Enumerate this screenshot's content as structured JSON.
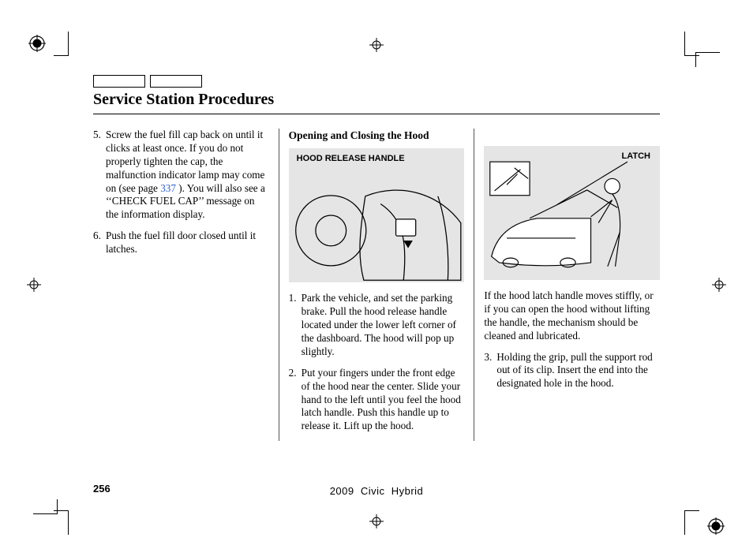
{
  "title": "Service Station Procedures",
  "subhead": "Opening and Closing the Hood",
  "col1": {
    "item5_num": "5.",
    "item5_a": "Screw the fuel fill cap back on until it clicks at least once. If you do not properly tighten the cap, the malfunction indicator lamp may come on (see page ",
    "item5_link": "337",
    "item5_b": " ). You will also see a ‘‘CHECK FUEL CAP’’ message on the information display.",
    "item6_num": "6.",
    "item6": "Push the fuel fill door closed until it latches."
  },
  "fig1_label": "HOOD RELEASE HANDLE",
  "fig2_label": "LATCH",
  "col2": {
    "item1_num": "1.",
    "item1": "Park the vehicle, and set the parking brake. Pull the hood release handle located under the lower left corner of the dashboard. The hood will pop up slightly.",
    "item2_num": "2.",
    "item2": "Put your fingers under the front edge of the hood near the center. Slide your hand to the left until you feel the hood latch handle. Push this handle up to release it. Lift up the hood."
  },
  "col3": {
    "para": "If the hood latch handle moves stiffly, or if you can open the hood without lifting the handle, the mechanism should be cleaned and lubricated.",
    "item3_num": "3.",
    "item3": "Holding the grip, pull the support rod out of its clip. Insert the end into the designated hole in the hood."
  },
  "page_num": "256",
  "model_line": "2009  Civic  Hybrid"
}
